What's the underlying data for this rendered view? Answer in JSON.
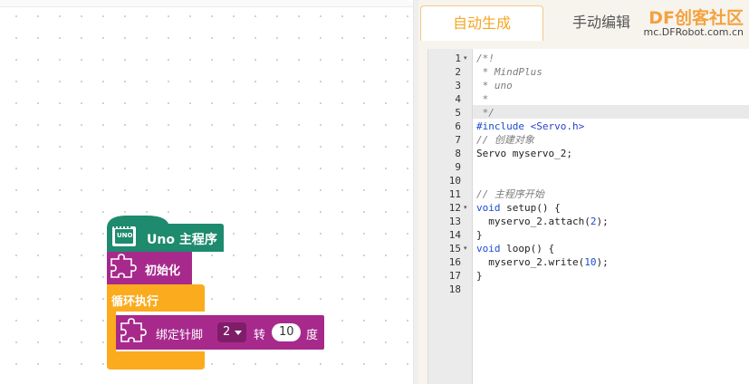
{
  "tabs": {
    "auto": "自动生成",
    "manual": "手动编辑"
  },
  "watermark": {
    "brand": "DF创客社区",
    "url": "mc.DFRobot.com.cn"
  },
  "blocks": {
    "main": {
      "label": "Uno 主程序",
      "board_icon_text": "UNO"
    },
    "init": {
      "label": "初始化"
    },
    "loop": {
      "label": "循环执行"
    },
    "servo": {
      "prefix": "绑定针脚",
      "pin": "2",
      "middle": "转",
      "angle": "10",
      "suffix": "度"
    }
  },
  "code": {
    "lines": [
      "/*!",
      " * MindPlus",
      " * uno",
      " *",
      " */",
      "#include <Servo.h>",
      "// 创建对象",
      "Servo myservo_2;",
      "",
      "",
      "// 主程序开始",
      "void setup() {",
      "  myservo_2.attach(2);",
      "}",
      "void loop() {",
      "  myservo_2.write(10);",
      "}",
      ""
    ],
    "line_numbers": [
      "1",
      "2",
      "3",
      "4",
      "5",
      "6",
      "7",
      "8",
      "9",
      "10",
      "11",
      "12",
      "13",
      "14",
      "15",
      "16",
      "17",
      "18"
    ],
    "fold_marker": "▾"
  },
  "colors": {
    "main_block": "#1e8a6e",
    "function_block": "#a8298c",
    "loop_block": "#fbab1e",
    "active_tab": "#f6a523"
  }
}
